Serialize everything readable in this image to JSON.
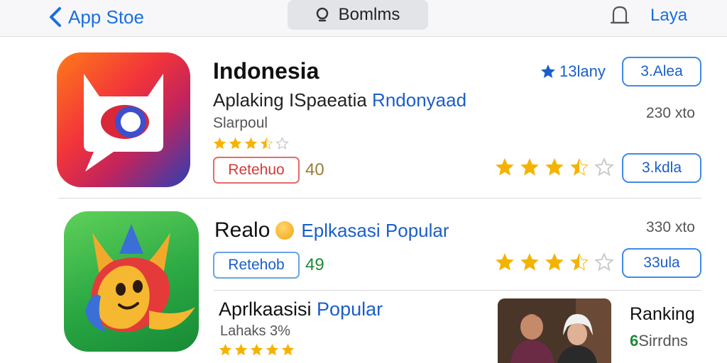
{
  "navbar": {
    "back_label": "App Stoe",
    "search_label": "Bomlms",
    "right_label": "Laya"
  },
  "apps": [
    {
      "title": "Indonesia",
      "subtitle_main": "Aplaking ISpaeatia ",
      "subtitle_accent": "Rndonyaad",
      "developer": "Slarpoul",
      "small_rating": 3.5,
      "tag": "Retehuo",
      "tag_number": "40",
      "top_rating": "13lany",
      "button_top": "3.Alea",
      "size": "230 xto",
      "big_rating": 3.5,
      "button_mid": "3.kdla"
    },
    {
      "title": "Realo",
      "subtitle_accent": "Eplkasasi Popular",
      "tag": "Retehob",
      "tag_number": "49",
      "size": "330 xto",
      "big_rating": 3.5,
      "button": "33ula"
    },
    {
      "title_main": "Aprlkaasisi ",
      "title_accent": "Popular",
      "subtitle": "Lahaks 3%",
      "small_rating": 5,
      "side_title": "Ranking",
      "side_badge": "6",
      "side_sub": "Sirrdns"
    }
  ],
  "colors": {
    "accent": "#1a6fe0",
    "star": "#f5b301",
    "star_empty": "#c8c8c8",
    "tag_red": "#d33a3a",
    "tag_green": "#1f8a34"
  },
  "icons": {
    "back": "chevron-left-icon",
    "search": "search-icon",
    "notification": "bell-icon",
    "rating": "star-icon"
  }
}
